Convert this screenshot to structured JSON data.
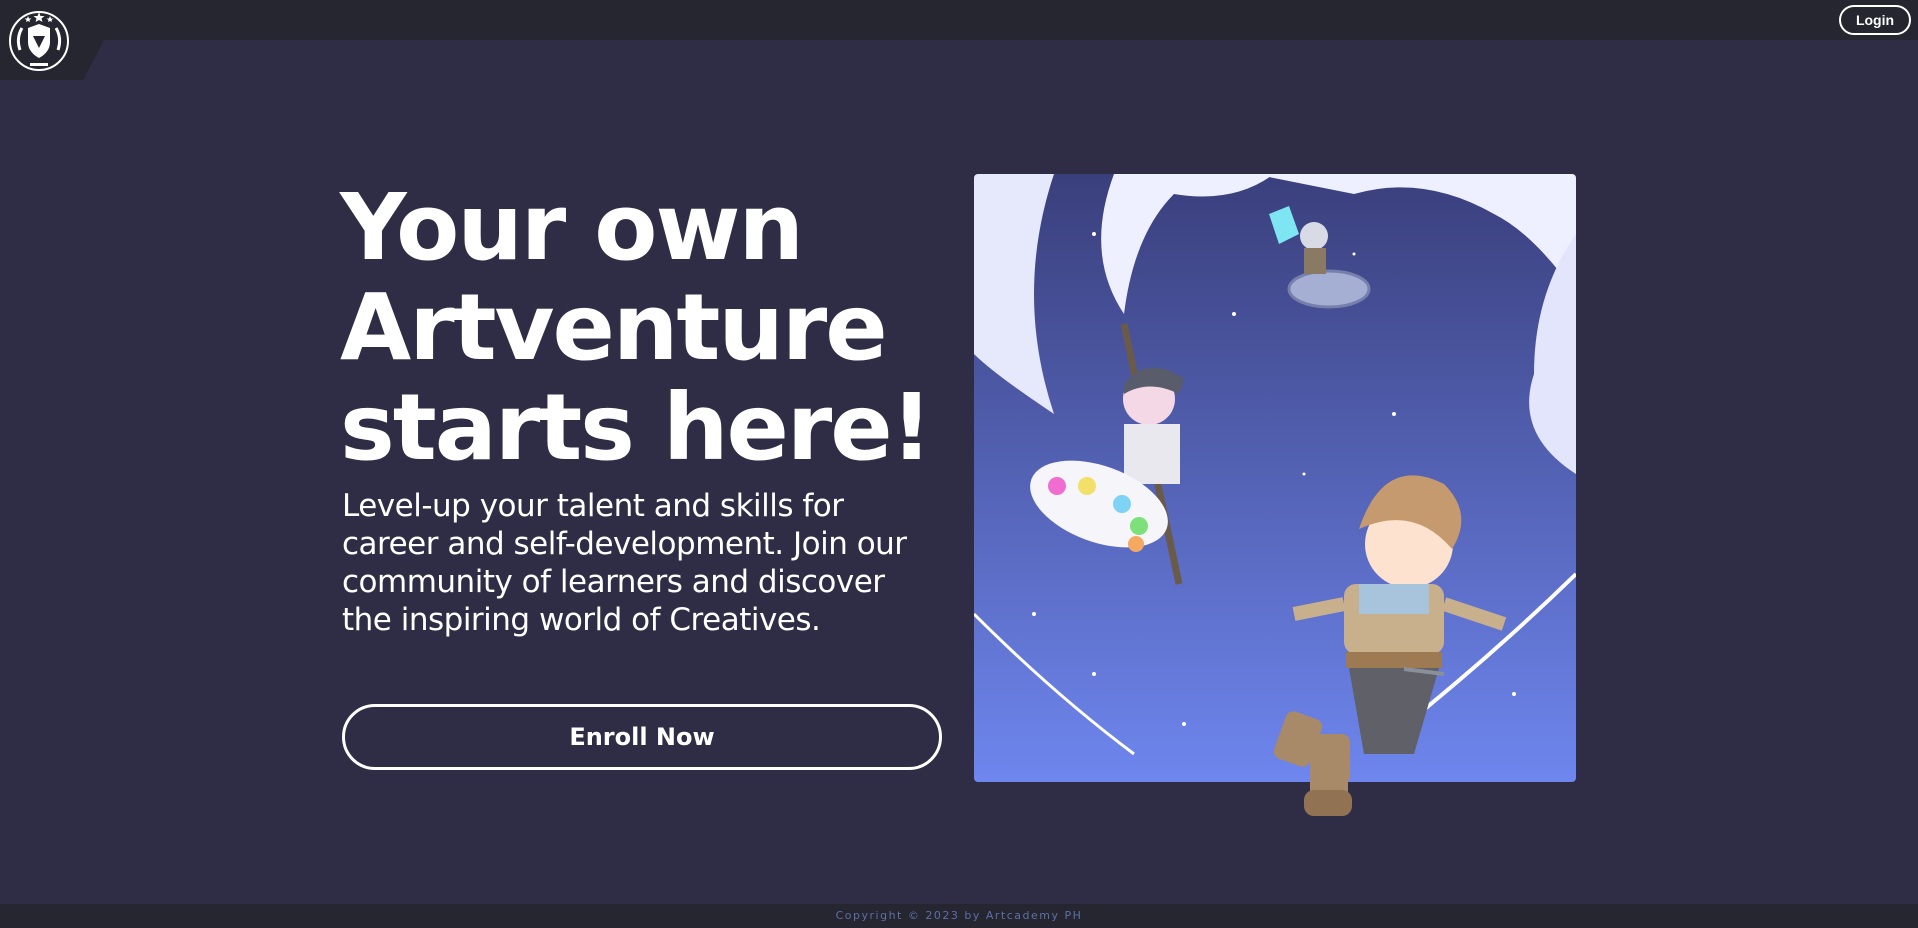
{
  "header": {
    "logo_icon": "academy-crest-icon",
    "login_label": "Login"
  },
  "hero": {
    "title_lines": [
      "Your own",
      "Artventure",
      "starts here!"
    ],
    "subtitle": "Level-up your talent and skills for career and self-development. Join our community of learners and discover the inspiring world of Creatives.",
    "enroll_label": "Enroll Now",
    "image_icon": "flying-chibi-artists-illustration"
  },
  "footer": {
    "copyright": "Copyright © 2023 by Artcademy PH"
  },
  "colors": {
    "page_bg": "#2e2d45",
    "bar_bg": "#25262f",
    "text": "#ffffff",
    "footer_text": "#5e6fa8",
    "sky_top": "#3a3f7c",
    "sky_bottom": "#6e86ee"
  }
}
